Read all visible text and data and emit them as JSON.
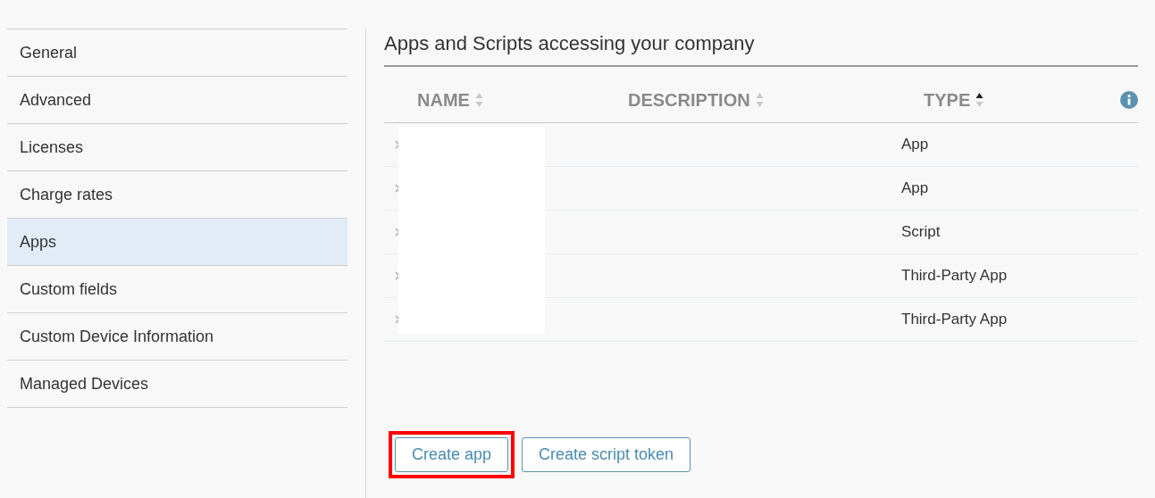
{
  "sidebar": {
    "items": [
      {
        "label": "General",
        "selected": false
      },
      {
        "label": "Advanced",
        "selected": false
      },
      {
        "label": "Licenses",
        "selected": false
      },
      {
        "label": "Charge rates",
        "selected": false
      },
      {
        "label": "Apps",
        "selected": true
      },
      {
        "label": "Custom fields",
        "selected": false
      },
      {
        "label": "Custom Device Information",
        "selected": false
      },
      {
        "label": "Managed Devices",
        "selected": false
      }
    ]
  },
  "content": {
    "title": "Apps and Scripts accessing your company",
    "table": {
      "columns": [
        {
          "label": "NAME",
          "sorted": false
        },
        {
          "label": "DESCRIPTION",
          "sorted": false
        },
        {
          "label": "TYPE",
          "sorted": true
        }
      ],
      "rows": [
        {
          "type": "App"
        },
        {
          "type": "App"
        },
        {
          "type": "Script"
        },
        {
          "type": "Third-Party App"
        },
        {
          "type": "Third-Party App"
        }
      ]
    },
    "buttons": [
      {
        "label": "Create app",
        "highlighted": true
      },
      {
        "label": "Create script token",
        "highlighted": false
      }
    ]
  }
}
